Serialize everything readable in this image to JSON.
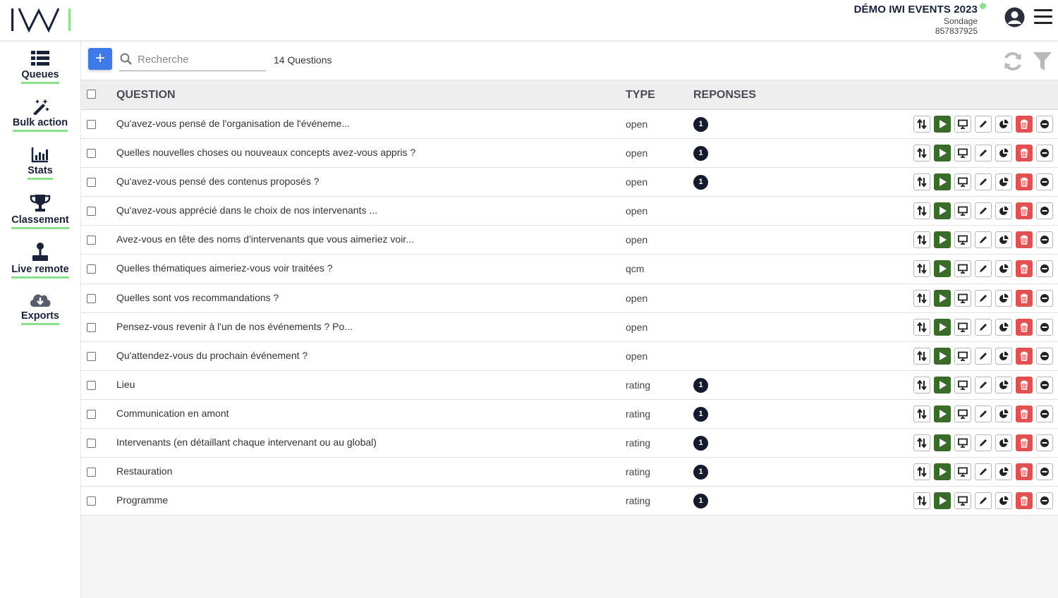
{
  "header": {
    "logo_text": "IWI",
    "event_title": "DÉMO IWI EVENTS 2023",
    "event_type": "Sondage",
    "event_id": "857837925",
    "status_color": "#8be08b"
  },
  "sidebar": {
    "items": [
      {
        "label": "Queues",
        "icon": "list-icon"
      },
      {
        "label": "Bulk action",
        "icon": "magic-wand-icon"
      },
      {
        "label": "Stats",
        "icon": "bar-chart-icon"
      },
      {
        "label": "Classement",
        "icon": "trophy-icon"
      },
      {
        "label": "Live remote",
        "icon": "joystick-icon"
      },
      {
        "label": "Exports",
        "icon": "cloud-download-icon"
      }
    ]
  },
  "toolbar": {
    "add_label": "+",
    "search_placeholder": "Recherche",
    "count_label": "14 Questions"
  },
  "table": {
    "headers": {
      "question": "QUESTION",
      "type": "TYPE",
      "responses": "REPONSES"
    },
    "rows": [
      {
        "question": "Qu'avez-vous pensé de l'organisation de l'événeme...",
        "type": "open",
        "responses": "1"
      },
      {
        "question": "Quelles nouvelles choses ou nouveaux concepts avez-vous appris ?",
        "type": "open",
        "responses": "1"
      },
      {
        "question": "Qu'avez-vous pensé des contenus proposés ?",
        "type": "open",
        "responses": "1"
      },
      {
        "question": "Qu'avez-vous apprécié dans le choix de nos intervenants ...",
        "type": "open",
        "responses": ""
      },
      {
        "question": "Avez-vous en tête des noms d'intervenants que vous aimeriez voir...",
        "type": "open",
        "responses": ""
      },
      {
        "question": "Quelles thématiques aimeriez-vous voir traitées ?",
        "type": "qcm",
        "responses": ""
      },
      {
        "question": "Quelles sont vos recommandations ?",
        "type": "open",
        "responses": ""
      },
      {
        "question": "Pensez-vous revenir à l'un de nos événements ? Po...",
        "type": "open",
        "responses": ""
      },
      {
        "question": "Qu'attendez-vous du prochain événement ?",
        "type": "open",
        "responses": ""
      },
      {
        "question": "Lieu",
        "type": "rating",
        "responses": "1"
      },
      {
        "question": "Communication en amont",
        "type": "rating",
        "responses": "1"
      },
      {
        "question": "Intervenants (en détaillant chaque intervenant ou au global)",
        "type": "rating",
        "responses": "1"
      },
      {
        "question": "Restauration",
        "type": "rating",
        "responses": "1"
      },
      {
        "question": "Programme",
        "type": "rating",
        "responses": "1"
      }
    ],
    "row_actions": [
      "sort-icon",
      "play-icon",
      "monitor-icon",
      "edit-icon",
      "pie-chart-icon",
      "trash-icon",
      "minus-circle-icon"
    ]
  },
  "colors": {
    "accent_blue": "#3f7be8",
    "play_green": "#3b6b2a",
    "delete_red": "#e25151",
    "nav_underline": "#8be08b",
    "badge_dark": "#151a2c"
  }
}
